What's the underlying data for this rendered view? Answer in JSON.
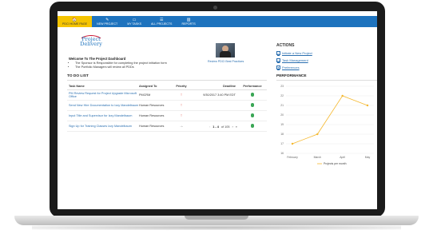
{
  "nav": {
    "items": [
      {
        "label": "PDCI HOME PAGE",
        "icon": "home-icon",
        "glyph": "🏠",
        "active": true
      },
      {
        "label": "NEW PROJECT",
        "icon": "pencil-icon",
        "glyph": "✎",
        "active": false
      },
      {
        "label": "MY TASKS",
        "icon": "tasks-icon",
        "glyph": "▭",
        "active": false
      },
      {
        "label": "ALL PROJECTS",
        "icon": "list-icon",
        "glyph": "☰",
        "active": false
      },
      {
        "label": "REPORTS",
        "icon": "reports-icon",
        "glyph": "▥",
        "active": false
      }
    ]
  },
  "welcome": {
    "logo_line1": "Project",
    "logo_line2": "Delivery",
    "title": "Welcome To The Project Dashboard",
    "bullets": [
      "The Sponsor is Responsible for completing the project initiation form",
      "The Portfolio Managers will review all PDDs"
    ],
    "photo_caption": "Review PDCI Best Practices"
  },
  "actions": {
    "title": "ACTIONS",
    "items": [
      {
        "label": "Initiate a New Project",
        "glyph": "✓"
      },
      {
        "label": "Task Management",
        "glyph": "▭"
      },
      {
        "label": "Preferences",
        "glyph": "✦"
      }
    ]
  },
  "todo": {
    "title": "TO DO LIST",
    "headers": [
      "Task Name",
      "Assigned To",
      "Priority",
      "Deadline",
      "Performance"
    ],
    "rows": [
      {
        "task": "PM Review Request for Project Upgrade Microsoft Office",
        "assigned": "PMCRM",
        "priority": "↑",
        "deadline": "9/30/2017 3:40 PM EDT"
      },
      {
        "task": "Send New Hire Documentation to Izzy Mandelbaum",
        "assigned": "Human Resources",
        "priority": "↑",
        "deadline": ""
      },
      {
        "task": "Input Title and Supervisor for Izzy Mandelbaum",
        "assigned": "Human Resources",
        "priority": "↑",
        "deadline": ""
      },
      {
        "task": "Sign Up for Training Classes Izzy Mandelbaum",
        "assigned": "Human Resources",
        "priority": "→",
        "deadline": ""
      }
    ],
    "pager": {
      "prev": "‹",
      "range": "1 - 4",
      "of": "of 105",
      "next": "›",
      "last": "»"
    }
  },
  "performance": {
    "title": "PERFORMANCE"
  },
  "colors": {
    "nav": "#1e73be",
    "active_tab": "#f5c400",
    "link": "#2a6fb0",
    "priority_high": "#d9281c",
    "performance_ok": "#3aa655",
    "chart_line": "#f5b82e"
  },
  "chart_data": {
    "type": "line",
    "x": [
      "February",
      "March",
      "April",
      "May"
    ],
    "series": [
      {
        "name": "Projects per month",
        "values": [
          17,
          18,
          22,
          21
        ]
      }
    ],
    "ylim": [
      16,
      23
    ],
    "yticks": [
      16,
      17,
      18,
      19,
      20,
      21,
      22,
      23
    ],
    "grid": true,
    "legend": "bottom"
  }
}
